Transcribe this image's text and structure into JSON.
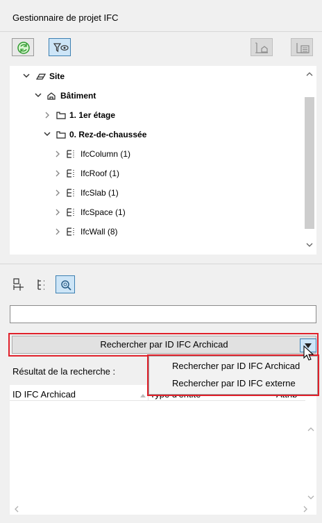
{
  "panel": {
    "title": "Gestionnaire de projet IFC"
  },
  "toolbar": [
    {
      "name": "refresh-button",
      "icon": "refresh-icon"
    },
    {
      "name": "filter-view-button",
      "icon": "filter-eye-icon"
    },
    {
      "name": "map-button",
      "icon": "map-icon"
    },
    {
      "name": "element-list-button",
      "icon": "element-list-icon"
    }
  ],
  "tree": [
    {
      "label": "Site",
      "icon": "site-icon",
      "expanded": true,
      "bold": true
    },
    {
      "label": "Bâtiment",
      "icon": "building-icon",
      "expanded": true,
      "bold": true
    },
    {
      "label": "1. 1er étage",
      "icon": "storey-icon",
      "expanded": false,
      "bold": true
    },
    {
      "label": "0. Rez-de-chaussée",
      "icon": "storey-icon",
      "expanded": true,
      "bold": true
    },
    {
      "label": "IfcColumn (1)",
      "icon": "ifc-type-icon",
      "expanded": false,
      "bold": false
    },
    {
      "label": "IfcRoof (1)",
      "icon": "ifc-type-icon",
      "expanded": false,
      "bold": false
    },
    {
      "label": "IfcSlab (1)",
      "icon": "ifc-type-icon",
      "expanded": false,
      "bold": false
    },
    {
      "label": "IfcSpace (1)",
      "icon": "ifc-type-icon",
      "expanded": false,
      "bold": false
    },
    {
      "label": "IfcWall (8)",
      "icon": "ifc-type-icon",
      "expanded": false,
      "bold": false
    }
  ],
  "midtoolbar": [
    {
      "name": "add-entity-button",
      "icon": "add-entity-icon"
    },
    {
      "name": "hierarchy-button",
      "icon": "hierarchy-icon"
    },
    {
      "name": "search-button",
      "icon": "search-icon"
    }
  ],
  "search": {
    "value": "",
    "mode_selected": "Rechercher par ID IFC Archicad"
  },
  "dropdown": {
    "options": [
      "Rechercher par ID IFC Archicad",
      "Rechercher par ID IFC externe"
    ]
  },
  "results": {
    "label": "Résultat de la recherche :",
    "columns": [
      "ID IFC Archicad",
      "Type d'entité",
      "Attrib"
    ]
  },
  "colors": {
    "highlight": "#e0202a",
    "selected": "#cde5f7",
    "accent": "#3c7fb1"
  }
}
